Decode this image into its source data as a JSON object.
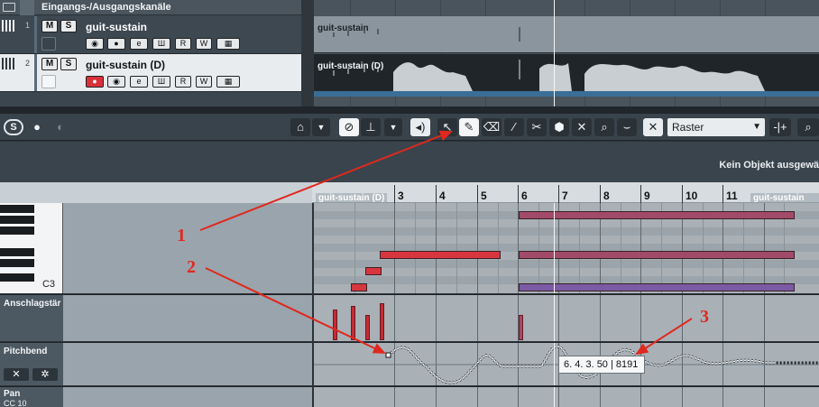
{
  "folder_track": {
    "label": "Eingangs-/Ausgangskanäle"
  },
  "tracks": [
    {
      "number": "1",
      "name": "guit-sustain",
      "btn_m": "M",
      "btn_s": "S",
      "btn_e": "e",
      "btn_r": "R",
      "btn_w": "W",
      "rec_enabled": false
    },
    {
      "number": "2",
      "name": "guit-sustain (D)",
      "btn_m": "M",
      "btn_s": "S",
      "btn_e": "e",
      "btn_r": "R",
      "btn_w": "W",
      "rec_enabled": true
    }
  ],
  "events": [
    {
      "label": "guit-sustain"
    },
    {
      "label": "guit-sustain (D)"
    }
  ],
  "toolbar": {
    "snap_select": {
      "value": "Raster"
    },
    "tools": [
      "object-selection",
      "draw",
      "erase",
      "trim",
      "split",
      "glue",
      "mute",
      "zoom",
      "line"
    ]
  },
  "infobar": {
    "text": "Kein Objekt ausgewä"
  },
  "ruler": {
    "part_label_left": "guit-sustain (D)",
    "part_label_right": "guit-sustain (D)",
    "bars": [
      "3",
      "4",
      "5",
      "6",
      "7",
      "8",
      "9",
      "10",
      "11"
    ]
  },
  "keyboard": {
    "c_label": "C3"
  },
  "controller_lanes": [
    {
      "id": "velocity",
      "label": "Anschlagstär"
    },
    {
      "id": "pitchbend",
      "label": "Pitchbend"
    },
    {
      "id": "pan",
      "label": "Pan",
      "sublabel": "CC 10"
    }
  ],
  "tooltip": {
    "text": "6. 4. 3. 50 | 8191"
  },
  "annotations": [
    "1",
    "2",
    "3"
  ],
  "colors": {
    "note_red": "#d8363f",
    "note_mauve": "#a24a6a",
    "note_purple": "#7b5aa6",
    "velocity": "#c52c36",
    "annotation_red": "#e0281e",
    "record_active": "#d9303c"
  }
}
